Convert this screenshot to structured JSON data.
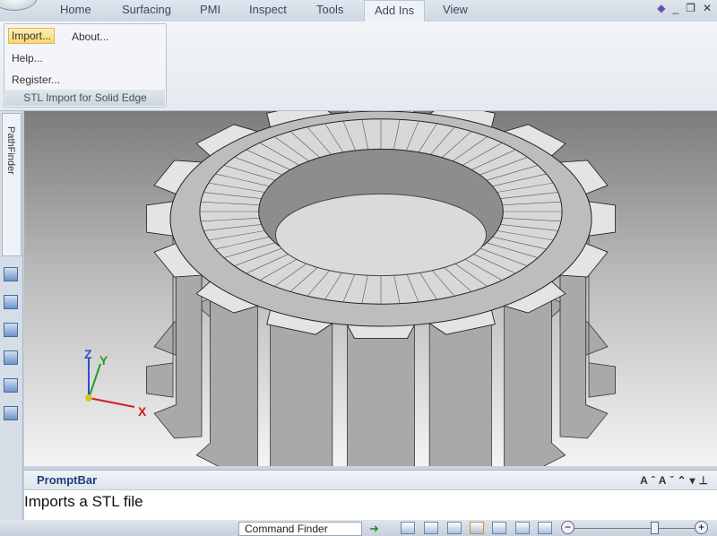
{
  "tabs": [
    "Home",
    "Surfacing",
    "PMI",
    "Inspect",
    "Tools",
    "Add Ins",
    "View"
  ],
  "active_tab": "Add Ins",
  "menu": {
    "import": "Import...",
    "about": "About...",
    "help": "Help...",
    "register": "Register...",
    "group": "STL Import for Solid Edge"
  },
  "sidebar": {
    "pathfinder": "PathFinder"
  },
  "triad": {
    "x": "X",
    "y": "Y",
    "z": "Z"
  },
  "promptbar": {
    "title": "PromptBar",
    "message": "Imports a STL file"
  },
  "status": {
    "command_finder": "Command Finder",
    "zoom_level": 0.64
  },
  "colors": {
    "model": "#a8a8a8",
    "accent": "#1f3f7a"
  }
}
